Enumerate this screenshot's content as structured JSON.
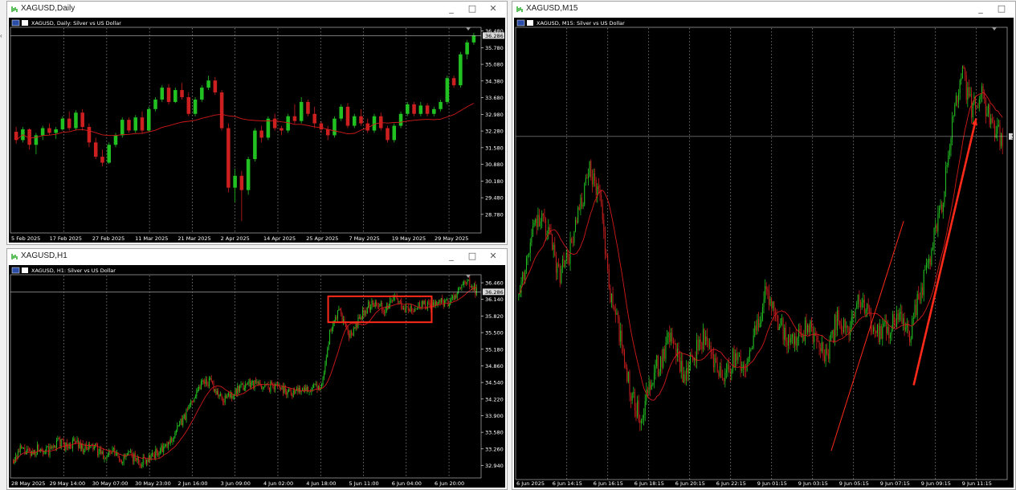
{
  "colors": {
    "bull": "#22c122",
    "bear": "#cc1f1f",
    "ma": "#d11a1a",
    "grid": "#ffffff",
    "annotation": "#ff2a1a",
    "bg": "#000000"
  },
  "windows": [
    {
      "id": "daily",
      "title": "XAGUSD,Daily",
      "header_symbol": "XAGUSD, Daily:  Silver vs US Dollar",
      "current_price": "36.286",
      "buttons": [
        "_",
        "□",
        "✕"
      ],
      "chart_data": {
        "type": "candlestick",
        "ylim": [
          28.0,
          36.6
        ],
        "y_ticks": [
          "36.480",
          "35.780",
          "35.080",
          "34.380",
          "33.680",
          "32.980",
          "32.280",
          "31.580",
          "30.880",
          "30.180",
          "29.480",
          "28.780"
        ],
        "x_ticks": [
          "5 Feb 2025",
          "17 Feb 2025",
          "27 Feb 2025",
          "11 Mar 2025",
          "21 Mar 2025",
          "2 Apr 2025",
          "14 Apr 2025",
          "25 Apr 2025",
          "7 May 2025",
          "19 May 2025",
          "29 May 2025"
        ],
        "candles": [
          [
            32.25,
            32.45,
            31.75,
            31.9
          ],
          [
            31.9,
            32.45,
            31.8,
            32.35
          ],
          [
            32.35,
            32.4,
            31.5,
            31.7
          ],
          [
            31.7,
            32.2,
            31.3,
            32.1
          ],
          [
            32.1,
            32.5,
            31.9,
            32.4
          ],
          [
            32.4,
            32.6,
            32.1,
            32.2
          ],
          [
            32.2,
            32.45,
            31.95,
            32.35
          ],
          [
            32.35,
            32.9,
            32.3,
            32.8
          ],
          [
            32.8,
            33.1,
            32.3,
            32.4
          ],
          [
            32.4,
            33.15,
            32.3,
            33.05
          ],
          [
            33.05,
            33.2,
            32.3,
            32.45
          ],
          [
            32.45,
            32.6,
            31.6,
            31.8
          ],
          [
            31.8,
            32.0,
            31.1,
            31.2
          ],
          [
            31.2,
            31.5,
            30.8,
            30.95
          ],
          [
            30.95,
            31.8,
            30.9,
            31.7
          ],
          [
            31.7,
            32.2,
            31.6,
            32.1
          ],
          [
            32.1,
            32.85,
            32.0,
            32.75
          ],
          [
            32.75,
            32.85,
            32.2,
            32.3
          ],
          [
            32.3,
            32.95,
            32.2,
            32.85
          ],
          [
            32.85,
            33.1,
            32.2,
            32.3
          ],
          [
            32.3,
            33.3,
            32.25,
            33.2
          ],
          [
            33.2,
            33.7,
            33.1,
            33.6
          ],
          [
            33.6,
            34.2,
            33.5,
            34.1
          ],
          [
            34.1,
            34.25,
            33.4,
            33.5
          ],
          [
            33.5,
            34.1,
            33.45,
            34.0
          ],
          [
            34.0,
            34.3,
            33.6,
            33.7
          ],
          [
            33.7,
            33.9,
            32.9,
            33.0
          ],
          [
            33.0,
            33.7,
            32.9,
            33.6
          ],
          [
            33.6,
            34.2,
            33.5,
            34.1
          ],
          [
            34.1,
            34.6,
            34.0,
            34.4
          ],
          [
            34.4,
            34.55,
            33.8,
            33.9
          ],
          [
            33.9,
            34.0,
            32.3,
            32.4
          ],
          [
            32.4,
            32.6,
            29.7,
            29.9
          ],
          [
            29.9,
            30.7,
            29.3,
            30.4
          ],
          [
            30.4,
            30.6,
            28.5,
            29.8
          ],
          [
            29.8,
            31.2,
            29.6,
            31.1
          ],
          [
            31.1,
            32.4,
            31.0,
            32.3
          ],
          [
            32.3,
            32.5,
            31.8,
            32.0
          ],
          [
            32.0,
            32.9,
            31.9,
            32.8
          ],
          [
            32.8,
            33.0,
            32.3,
            32.4
          ],
          [
            32.4,
            32.5,
            32.1,
            32.3
          ],
          [
            32.3,
            33.0,
            32.2,
            32.9
          ],
          [
            32.9,
            33.4,
            32.6,
            32.7
          ],
          [
            32.7,
            33.7,
            32.6,
            33.5
          ],
          [
            33.5,
            33.6,
            32.9,
            33.0
          ],
          [
            33.0,
            33.3,
            32.4,
            32.6
          ],
          [
            32.6,
            32.7,
            32.2,
            32.35
          ],
          [
            32.35,
            32.5,
            31.9,
            32.1
          ],
          [
            32.1,
            32.9,
            32.0,
            32.8
          ],
          [
            32.8,
            33.4,
            32.7,
            33.3
          ],
          [
            33.3,
            33.45,
            32.4,
            32.5
          ],
          [
            32.5,
            33.0,
            32.4,
            32.9
          ],
          [
            32.9,
            33.2,
            32.5,
            32.6
          ],
          [
            32.6,
            32.8,
            32.2,
            32.3
          ],
          [
            32.3,
            33.0,
            32.2,
            32.9
          ],
          [
            32.9,
            33.05,
            32.3,
            32.4
          ],
          [
            32.4,
            32.5,
            31.8,
            31.9
          ],
          [
            31.9,
            32.6,
            31.8,
            32.5
          ],
          [
            32.5,
            33.1,
            32.4,
            33.0
          ],
          [
            33.0,
            33.5,
            32.9,
            33.4
          ],
          [
            33.4,
            33.5,
            32.9,
            33.0
          ],
          [
            33.0,
            33.5,
            32.9,
            33.35
          ],
          [
            33.35,
            33.45,
            32.9,
            33.0
          ],
          [
            33.0,
            33.3,
            32.9,
            33.2
          ],
          [
            33.2,
            33.6,
            33.1,
            33.5
          ],
          [
            33.5,
            34.6,
            33.4,
            34.5
          ],
          [
            34.5,
            34.6,
            34.1,
            34.2
          ],
          [
            34.2,
            35.6,
            34.1,
            35.5
          ],
          [
            35.5,
            36.1,
            35.3,
            36.0
          ],
          [
            36.0,
            36.4,
            35.9,
            36.3
          ]
        ],
        "ma_period": 20
      }
    },
    {
      "id": "h1",
      "title": "XAGUSD,H1",
      "header_symbol": "XAGUSD, H1:  Silver vs US Dollar",
      "current_price": "36.286",
      "buttons": [
        "_",
        "□",
        "✕"
      ],
      "chart_data": {
        "type": "candlestick",
        "ylim": [
          32.7,
          36.6
        ],
        "y_ticks": [
          "36.460",
          "36.140",
          "35.820",
          "35.500",
          "35.180",
          "34.860",
          "34.540",
          "34.220",
          "33.900",
          "33.580",
          "33.260",
          "32.940"
        ],
        "x_ticks": [
          "28 May 2025",
          "29 May 14:00",
          "30 May 07:00",
          "30 May 23:00",
          "2 Jun 16:00",
          "3 Jun 09:00",
          "4 Jun 02:00",
          "4 Jun 18:00",
          "5 Jun 11:00",
          "6 Jun 04:00",
          "6 Jun 20:00"
        ],
        "segments": [
          [
            33.05,
            33.25,
            33.15,
            33.3,
            33.2,
            33.4,
            33.3,
            33.4,
            33.25,
            33.3,
            33.1,
            33.2,
            33.05,
            33.15,
            33.0,
            33.1,
            33.2,
            33.3
          ],
          [
            33.3,
            33.6,
            33.9,
            34.3,
            34.6,
            34.5,
            34.2,
            34.3,
            34.4,
            34.55,
            34.5,
            34.45,
            34.5,
            34.4,
            34.35,
            34.45,
            34.4,
            34.5
          ],
          [
            34.5,
            35.6,
            35.9,
            35.4,
            35.7,
            36.0,
            36.1,
            35.95,
            36.15,
            36.0,
            35.9,
            36.05,
            36.0,
            36.1,
            36.05,
            36.3,
            36.45,
            36.3
          ]
        ],
        "ma_period": 20
      }
    },
    {
      "id": "m15",
      "title": "XAGUSD,M15",
      "header_symbol": "XAGUSD, M15:  Silver vs US Dollar",
      "current_price": "36.286",
      "buttons": [
        "_",
        "□"
      ],
      "chart_data": {
        "type": "candlestick",
        "ylim": [
          35.45,
          36.55
        ],
        "x_ticks": [
          "6 Jun 2025",
          "6 Jun 14:15",
          "6 Jun 16:15",
          "6 Jun 18:15",
          "6 Jun 20:15",
          "6 Jun 22:15",
          "9 Jun 01:15",
          "9 Jun 03:15",
          "9 Jun 05:15",
          "9 Jun 07:15",
          "9 Jun 09:15",
          "9 Jun 11:15"
        ],
        "segments": [
          [
            35.9,
            36.0,
            36.1,
            36.05,
            35.95,
            36.0,
            36.1,
            36.2,
            36.15,
            35.9,
            35.8,
            35.65,
            35.6,
            35.7,
            35.75,
            35.8,
            35.7,
            35.75,
            35.8,
            35.75,
            35.7,
            35.75,
            35.72,
            35.8,
            35.9,
            35.85,
            35.8,
            35.78,
            35.82,
            35.8,
            35.75,
            35.85,
            35.8,
            35.9,
            35.85,
            35.8,
            35.82,
            35.85,
            35.8,
            35.9,
            36.0,
            36.1,
            36.3,
            36.45,
            36.35,
            36.4,
            36.3,
            36.28
          ]
        ],
        "ma_period": 20
      }
    }
  ]
}
